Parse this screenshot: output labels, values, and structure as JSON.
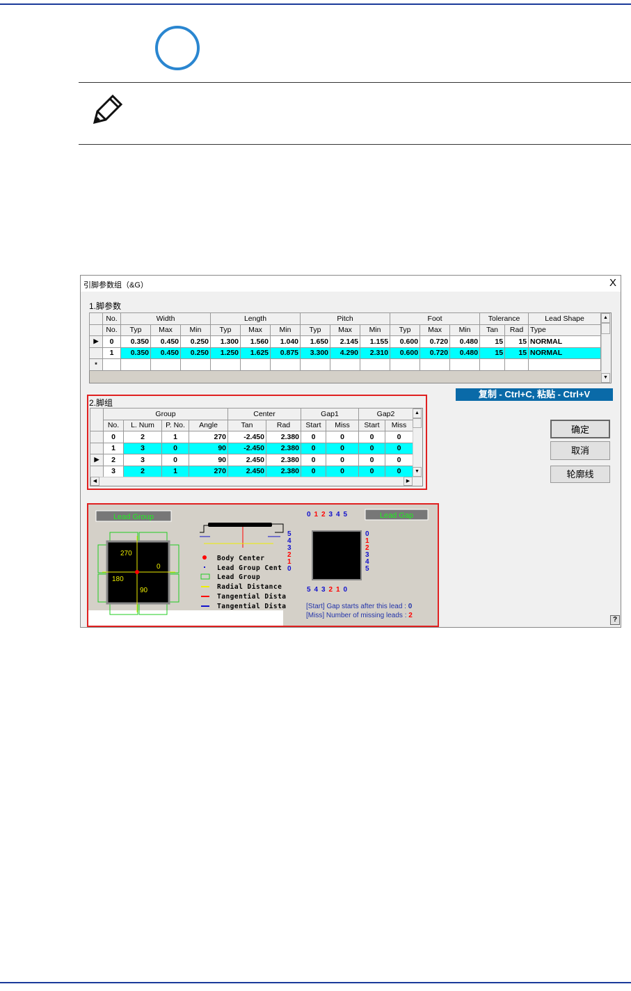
{
  "dialog": {
    "title": "引脚参数组（&G）",
    "close": "X"
  },
  "section1": {
    "label": "1.脚参数",
    "group_headers": [
      "No.",
      "Width",
      "Length",
      "Pitch",
      "Foot",
      "Tolerance",
      "Lead Shape"
    ],
    "sub_headers": [
      "No.",
      "Typ",
      "Max",
      "Min",
      "Typ",
      "Max",
      "Min",
      "Typ",
      "Max",
      "Min",
      "Typ",
      "Max",
      "Min",
      "Tan",
      "Rad",
      "Type"
    ],
    "rows": [
      {
        "cells": [
          "0",
          "0.350",
          "0.450",
          "0.250",
          "1.300",
          "1.560",
          "1.040",
          "1.650",
          "2.145",
          "1.155",
          "0.600",
          "0.720",
          "0.480",
          "15",
          "15",
          "NORMAL"
        ],
        "current": true,
        "selected": false
      },
      {
        "cells": [
          "1",
          "0.350",
          "0.450",
          "0.250",
          "1.250",
          "1.625",
          "0.875",
          "3.300",
          "4.290",
          "2.310",
          "0.600",
          "0.720",
          "0.480",
          "15",
          "15",
          "NORMAL"
        ],
        "current": false,
        "selected": true
      }
    ],
    "new_row_marker": "*"
  },
  "section2": {
    "label": "2.脚组",
    "group_headers": [
      "Group",
      "Center",
      "Gap1",
      "Gap2"
    ],
    "sub_headers": [
      "No.",
      "L. Num",
      "P. No.",
      "Angle",
      "Tan",
      "Rad",
      "Start",
      "Miss",
      "Start",
      "Miss"
    ],
    "rows": [
      {
        "cells": [
          "0",
          "2",
          "1",
          "270",
          "-2.450",
          "2.380",
          "0",
          "0",
          "0",
          "0"
        ],
        "current": false,
        "selected": false
      },
      {
        "cells": [
          "1",
          "3",
          "0",
          "90",
          "-2.450",
          "2.380",
          "0",
          "0",
          "0",
          "0"
        ],
        "current": false,
        "selected": true
      },
      {
        "cells": [
          "2",
          "3",
          "0",
          "90",
          "2.450",
          "2.380",
          "0",
          "0",
          "0",
          "0"
        ],
        "current": true,
        "selected": false
      },
      {
        "cells": [
          "3",
          "2",
          "1",
          "270",
          "2.450",
          "2.380",
          "0",
          "0",
          "0",
          "0"
        ],
        "current": false,
        "selected": true
      }
    ]
  },
  "copy_hint": "复制 - Ctrl+C, 粘贴 - Ctrl+V",
  "buttons": {
    "ok": "确定",
    "cancel": "取消",
    "outline": "轮廓线",
    "help": "?"
  },
  "diagram": {
    "lead_group_title": "Lead Group",
    "lead_gap_title": "Lead Gap",
    "angles": [
      "270",
      "0",
      "180",
      "90"
    ],
    "legend": [
      "Body Center",
      "Lead Group Cent",
      "Lead Group",
      "Radial Distance",
      "Tangential Dista",
      "Tangential Dista"
    ],
    "gap_numbers": [
      "0",
      "1",
      "2",
      "3",
      "4",
      "5"
    ],
    "start_note": "[Start] Gap starts after this lead : ",
    "start_value": "0",
    "miss_note": "[Miss] Number of missing leads : ",
    "miss_value": "2"
  }
}
